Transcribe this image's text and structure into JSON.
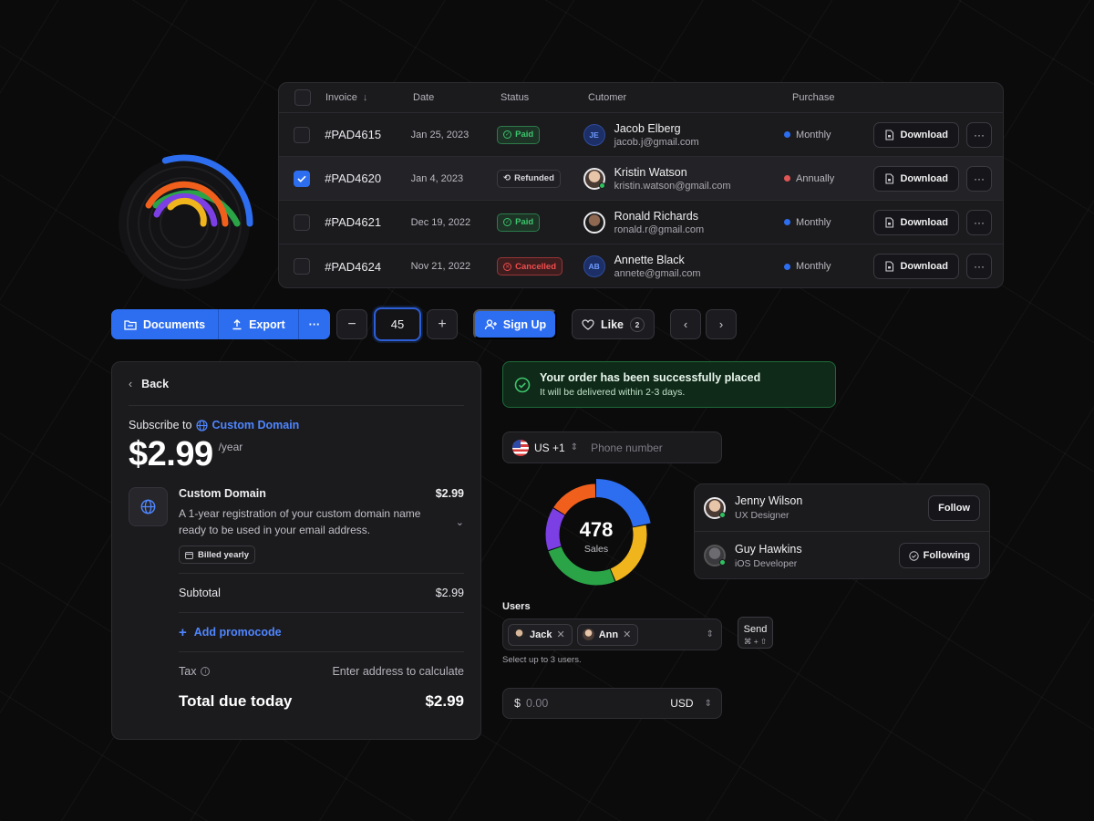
{
  "table": {
    "headers": {
      "invoice": "Invoice",
      "date": "Date",
      "status": "Status",
      "customer": "Cutomer",
      "purchase": "Purchase"
    },
    "download_label": "Download",
    "rows": [
      {
        "invoice": "#PAD4615",
        "date": "Jan 25, 2023",
        "status": "Paid",
        "status_kind": "paid",
        "customer": "Jacob Elberg",
        "email": "jacob.j@gmail.com",
        "initials": "JE",
        "purchase": "Monthly",
        "purchase_color": "#2d6ef0",
        "checked": false
      },
      {
        "invoice": "#PAD4620",
        "date": "Jan 4, 2023",
        "status": "Refunded",
        "status_kind": "refunded",
        "customer": "Kristin Watson",
        "email": "kristin.watson@gmail.com",
        "initials": "",
        "purchase": "Annually",
        "purchase_color": "#e05555",
        "checked": true
      },
      {
        "invoice": "#PAD4621",
        "date": "Dec 19, 2022",
        "status": "Paid",
        "status_kind": "paid",
        "customer": "Ronald Richards",
        "email": "ronald.r@gmail.com",
        "initials": "",
        "purchase": "Monthly",
        "purchase_color": "#2d6ef0",
        "checked": false
      },
      {
        "invoice": "#PAD4624",
        "date": "Nov 21, 2022",
        "status": "Cancelled",
        "status_kind": "cancelled",
        "customer": "Annette Black",
        "email": "annete@gmail.com",
        "initials": "AB",
        "purchase": "Monthly",
        "purchase_color": "#2d6ef0",
        "checked": false
      }
    ]
  },
  "toolbar": {
    "documents_label": "Documents",
    "export_label": "Export",
    "stepper_value": "45",
    "signup_label": "Sign Up",
    "like_label": "Like",
    "like_count": "2"
  },
  "subscription": {
    "back_label": "Back",
    "subscribe_prefix": "Subscribe to",
    "product_link": "Custom Domain",
    "price": "$2.99",
    "period": "/year",
    "item_title": "Custom Domain",
    "item_price": "$2.99",
    "item_desc": "A 1-year registration of your custom domain name ready to be used in your email address.",
    "billed_label": "Billed yearly",
    "subtotal_label": "Subtotal",
    "subtotal_value": "$2.99",
    "promo_label": "Add promocode",
    "tax_label": "Tax",
    "tax_value": "Enter address to calculate",
    "total_label": "Total due today",
    "total_value": "$2.99"
  },
  "alert": {
    "title": "Your order has been successfully placed",
    "subtitle": "It will be delivered within 2-3 days."
  },
  "phone": {
    "country_code": "US +1",
    "placeholder": "Phone number"
  },
  "donut": {
    "value": "478",
    "label": "Sales"
  },
  "chart_data": {
    "type": "pie",
    "values": [
      22,
      22,
      26,
      14,
      16
    ],
    "colors": [
      "#2d6ef0",
      "#f0b51c",
      "#2aa447",
      "#7b3fe4",
      "#f0601c"
    ],
    "center_value": "478",
    "center_label": "Sales"
  },
  "people": [
    {
      "name": "Jenny Wilson",
      "role": "UX Designer",
      "action": "Follow"
    },
    {
      "name": "Guy Hawkins",
      "role": "iOS Developer",
      "action": "Following"
    }
  ],
  "users": {
    "label": "Users",
    "chips": [
      "Jack",
      "Ann"
    ],
    "hint": "Select up to 3 users.",
    "send_label": "Send",
    "send_shortcut": "⌘ + ⇧"
  },
  "amount": {
    "symbol": "$",
    "placeholder": "0.00",
    "currency": "USD"
  },
  "colors": {
    "accent": "#2d6ef0",
    "success": "#3ec46d",
    "danger": "#f24d4d"
  }
}
